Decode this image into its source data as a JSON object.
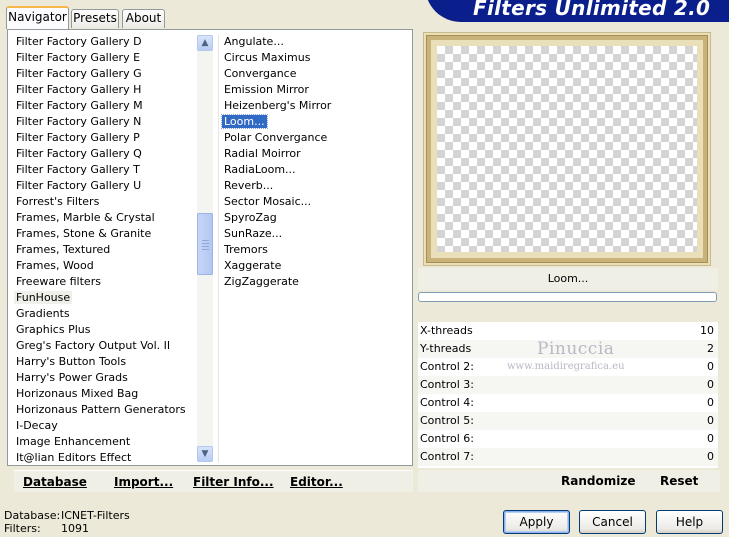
{
  "window": {
    "banner_title": "Filters Unlimited 2.0"
  },
  "tabs": [
    {
      "label": "Navigator",
      "active": true
    },
    {
      "label": "Presets",
      "active": false
    },
    {
      "label": "About",
      "active": false
    }
  ],
  "categories": [
    "Filter Factory Gallery D",
    "Filter Factory Gallery E",
    "Filter Factory Gallery G",
    "Filter Factory Gallery H",
    "Filter Factory Gallery M",
    "Filter Factory Gallery N",
    "Filter Factory Gallery P",
    "Filter Factory Gallery Q",
    "Filter Factory Gallery T",
    "Filter Factory Gallery U",
    "Forrest's Filters",
    "Frames, Marble & Crystal",
    "Frames, Stone & Granite",
    "Frames, Textured",
    "Frames, Wood",
    "Freeware filters",
    "FunHouse",
    "Gradients",
    "Graphics Plus",
    "Greg's Factory Output Vol. II",
    "Harry's Button Tools",
    "Harry's Power Grads",
    "Horizonaus Mixed Bag",
    "Horizonaus Pattern Generators",
    "I-Decay",
    "Image Enhancement",
    "It@lian Editors Effect"
  ],
  "selected_category": "FunHouse",
  "filters": [
    "Angulate...",
    "Circus Maximus",
    "Convergance",
    "Emission Mirror",
    "Heizenberg's Mirror",
    "Loom...",
    "Polar Convergance",
    "Radial Moirror",
    "RadiaLoom...",
    "Reverb...",
    "Sector Mosaic...",
    "SpyroZag",
    "SunRaze...",
    "Tremors",
    "Xaggerate",
    "ZigZaggerate"
  ],
  "selected_filter": "Loom...",
  "left_toolbar": {
    "database": "Database",
    "import": "Import...",
    "filter_info": "Filter Info...",
    "editor": "Editor..."
  },
  "preview": {
    "filter_name": "Loom...",
    "progress": 0
  },
  "controls": [
    {
      "label": "X-threads",
      "value": "10"
    },
    {
      "label": "Y-threads",
      "value": "2"
    },
    {
      "label": "Control 2:",
      "value": "0"
    },
    {
      "label": "Control 3:",
      "value": "0"
    },
    {
      "label": "Control 4:",
      "value": "0"
    },
    {
      "label": "Control 5:",
      "value": "0"
    },
    {
      "label": "Control 6:",
      "value": "0"
    },
    {
      "label": "Control 7:",
      "value": "0"
    }
  ],
  "watermark": {
    "name": "Pinuccia",
    "url": "www.maidiregrafica.eu"
  },
  "right_toolbar": {
    "randomize": "Randomize",
    "reset": "Reset"
  },
  "status": {
    "database_label": "Database:",
    "database_value": "ICNET-Filters",
    "filters_label": "Filters:",
    "filters_value": "1091"
  },
  "buttons": {
    "apply": "Apply",
    "cancel": "Cancel",
    "help": "Help"
  },
  "colors": {
    "banner": "#0a1e8c",
    "selection": "#316ac5",
    "frame_gold": "#c9b37a"
  }
}
